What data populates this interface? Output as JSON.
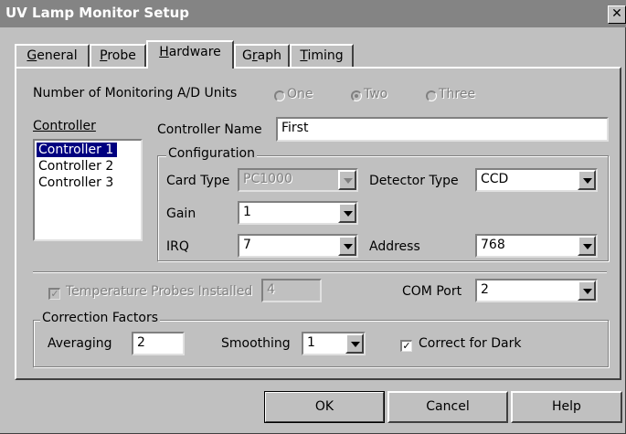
{
  "window": {
    "title": "UV Lamp Monitor Setup",
    "close_glyph": "✕"
  },
  "tabs": [
    {
      "label": "General",
      "u": "G",
      "rest": "eneral"
    },
    {
      "label": "Probe",
      "u": "P",
      "rest": "robe"
    },
    {
      "label": "Hardware",
      "u": "H",
      "rest": "ardware"
    },
    {
      "label": "Graph",
      "pre": "G",
      "u": "r",
      "rest": "aph"
    },
    {
      "label": "Timing",
      "u": "T",
      "rest": "iming"
    }
  ],
  "active_tab": "Hardware",
  "units": {
    "label": "Number of Monitoring A/D Units",
    "options": [
      {
        "label": "One",
        "selected": false
      },
      {
        "label": "Two",
        "selected": true
      },
      {
        "label": "Three",
        "selected": false
      }
    ]
  },
  "controller": {
    "label": "Controller",
    "items": [
      "Controller 1",
      "Controller 2",
      "Controller 3"
    ],
    "selected_index": 0
  },
  "controller_name": {
    "label": "Controller Name",
    "value": "First"
  },
  "configuration": {
    "label": "Configuration",
    "card_type": {
      "label": "Card Type",
      "value": "PC1000"
    },
    "detector_type": {
      "label": "Detector Type",
      "value": "CCD"
    },
    "gain": {
      "label": "Gain",
      "value": "1"
    },
    "irq": {
      "label": "IRQ",
      "value": "7"
    },
    "address": {
      "label": "Address",
      "value": "768"
    }
  },
  "temperature": {
    "label": "Temperature Probes Installed",
    "checked": true,
    "value": "4"
  },
  "com_port": {
    "label": "COM Port",
    "value": "2"
  },
  "correction": {
    "label": "Correction Factors",
    "averaging": {
      "label": "Averaging",
      "value": "2"
    },
    "smoothing": {
      "label": "Smoothing",
      "value": "1"
    },
    "correct_dark": {
      "label": "Correct for Dark",
      "checked": true
    }
  },
  "buttons": {
    "ok": "OK",
    "cancel": "Cancel",
    "help": "Help"
  },
  "colors": {
    "title_bar": "#848484",
    "face": "#c0c0c0",
    "selection": "#000080"
  }
}
